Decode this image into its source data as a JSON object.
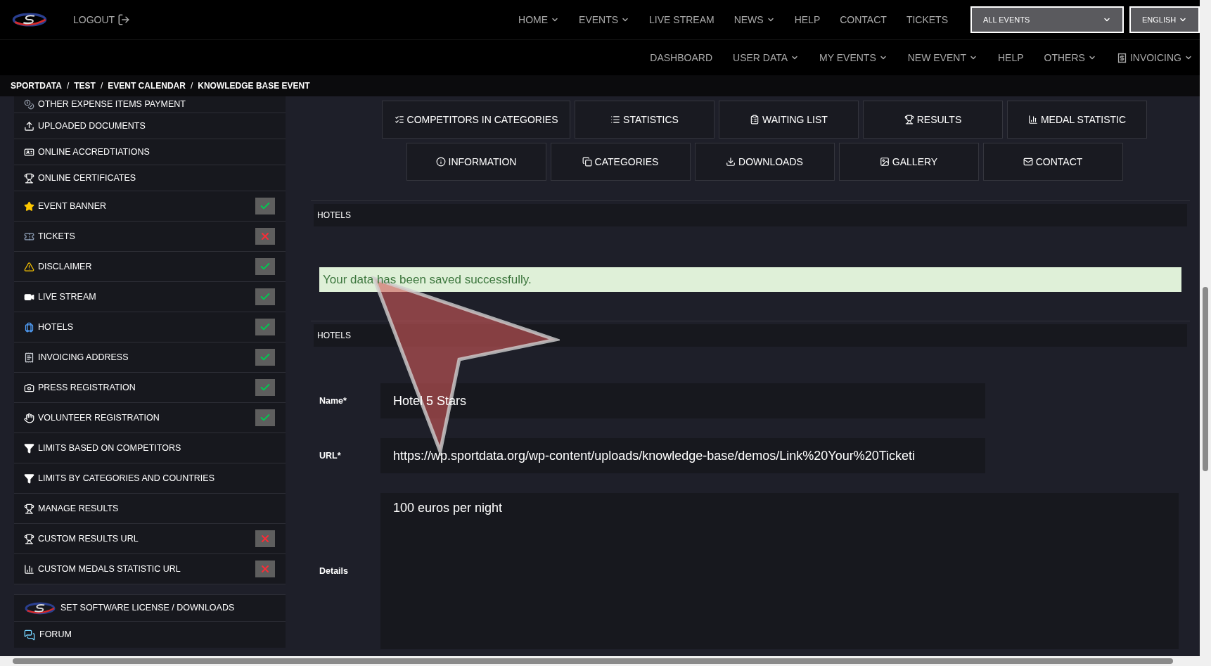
{
  "top_nav": {
    "logout": "LOGOUT",
    "items": [
      {
        "label": "HOME",
        "dropdown": true
      },
      {
        "label": "EVENTS",
        "dropdown": true
      },
      {
        "label": "LIVE STREAM",
        "dropdown": false
      },
      {
        "label": "NEWS",
        "dropdown": true
      },
      {
        "label": "HELP",
        "dropdown": false
      },
      {
        "label": "CONTACT",
        "dropdown": false
      },
      {
        "label": "TICKETS",
        "dropdown": false
      }
    ],
    "selects": [
      {
        "value": "ALL EVENTS"
      },
      {
        "value": "ENGLISH"
      }
    ]
  },
  "sub_nav": {
    "items": [
      {
        "label": "DASHBOARD",
        "dropdown": false
      },
      {
        "label": "USER DATA",
        "dropdown": true
      },
      {
        "label": "MY EVENTS",
        "dropdown": true
      },
      {
        "label": "NEW EVENT",
        "dropdown": true
      },
      {
        "label": "HELP",
        "dropdown": false
      },
      {
        "label": "OTHERS",
        "dropdown": true
      },
      {
        "label": "INVOICING",
        "dropdown": true
      }
    ]
  },
  "breadcrumb": {
    "separator": "/",
    "items": [
      "SPORTDATA",
      "TEST",
      "EVENT CALENDAR",
      "KNOWLEDGE BASE EVENT"
    ]
  },
  "sidebar": {
    "items": [
      {
        "label": "OTHER EXPENSE ITEMS PAYMENT"
      },
      {
        "label": "UPLOADED DOCUMENTS"
      },
      {
        "label": "ONLINE ACCREDTIATIONS"
      },
      {
        "label": "ONLINE CERTIFICATES"
      },
      {
        "label": "EVENT BANNER",
        "complete": true
      },
      {
        "label": "TICKETS",
        "complete": false
      },
      {
        "label": "DISCLAIMER",
        "complete": true
      },
      {
        "label": "LIVE STREAM",
        "complete": true
      },
      {
        "label": "HOTELS",
        "complete": true
      },
      {
        "label": "INVOICING ADDRESS",
        "complete": true
      },
      {
        "label": "PRESS REGISTRATION",
        "complete": true
      },
      {
        "label": "VOLUNTEER REGISTRATION",
        "complete": true
      },
      {
        "label": "LIMITS BASED ON COMPETITORS"
      },
      {
        "label": "LIMITS BY CATEGORIES AND COUNTRIES"
      },
      {
        "label": "MANAGE RESULTS"
      },
      {
        "label": "CUSTOM RESULTS URL",
        "complete": false
      },
      {
        "label": "CUSTOM MEDALS STATISTIC URL",
        "complete": false
      }
    ],
    "footer_items": [
      {
        "label": "SET SOFTWARE LICENSE / DOWNLOADS"
      },
      {
        "label": "FORUM"
      }
    ]
  },
  "event_tabs": [
    [
      "COMPETITORS IN CATEGORIES",
      "STATISTICS",
      "WAITING LIST",
      "RESULTS",
      "MEDAL STATISTIC"
    ],
    [
      "INFORMATION",
      "CATEGORIES",
      "DOWNLOADS",
      "GALLERY",
      "CONTACT"
    ]
  ],
  "sections": [
    {
      "title": "HOTELS"
    },
    {
      "title": "HOTELS"
    }
  ],
  "alert": {
    "text": "Your data has been saved successfully."
  },
  "form": {
    "fields": [
      {
        "label": "Name*",
        "value": "Hotel 5 Stars",
        "kind": "input"
      },
      {
        "label": "URL*",
        "value": "https://wp.sportdata.org/wp-content/uploads/knowledge-base/demos/Link%20Your%20Ticketi",
        "kind": "input"
      },
      {
        "label": "Details",
        "value": "100 euros per night",
        "kind": "textarea"
      }
    ]
  }
}
